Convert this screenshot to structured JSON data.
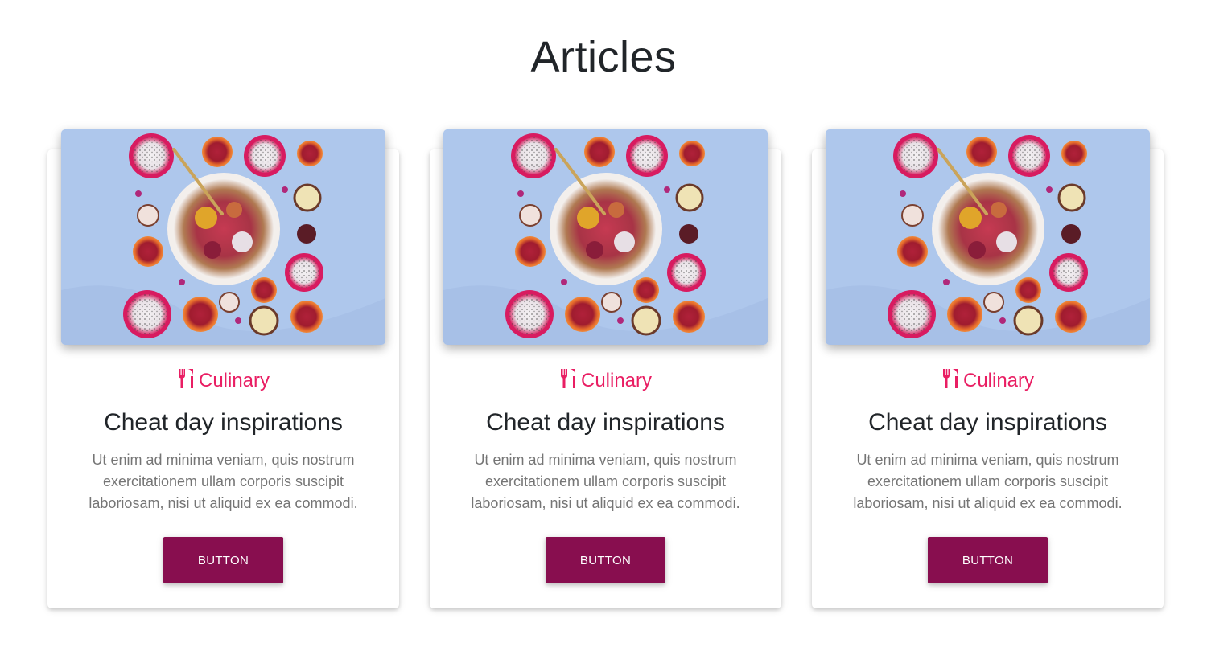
{
  "page": {
    "title": "Articles"
  },
  "colors": {
    "accent": "#e91e63",
    "button_bg": "#880e4f",
    "button_text": "#ffffff",
    "heading": "#212529",
    "body_text": "#757575",
    "image_bg": "#a9c3ea"
  },
  "cards": [
    {
      "image_icon": "fruit-bowl-photo",
      "category_icon": "fork-knife-icon",
      "category": "Culinary",
      "title": "Cheat day inspirations",
      "text": "Ut enim ad minima veniam, quis nostrum exercitationem ullam corporis suscipit laboriosam, nisi ut aliquid ex ea commodi.",
      "button_label": "BUTTON"
    },
    {
      "image_icon": "fruit-bowl-photo",
      "category_icon": "fork-knife-icon",
      "category": "Culinary",
      "title": "Cheat day inspirations",
      "text": "Ut enim ad minima veniam, quis nostrum exercitationem ullam corporis suscipit laboriosam, nisi ut aliquid ex ea commodi.",
      "button_label": "BUTTON"
    },
    {
      "image_icon": "fruit-bowl-photo",
      "category_icon": "fork-knife-icon",
      "category": "Culinary",
      "title": "Cheat day inspirations",
      "text": "Ut enim ad minima veniam, quis nostrum exercitationem ullam corporis suscipit laboriosam, nisi ut aliquid ex ea commodi.",
      "button_label": "BUTTON"
    }
  ]
}
